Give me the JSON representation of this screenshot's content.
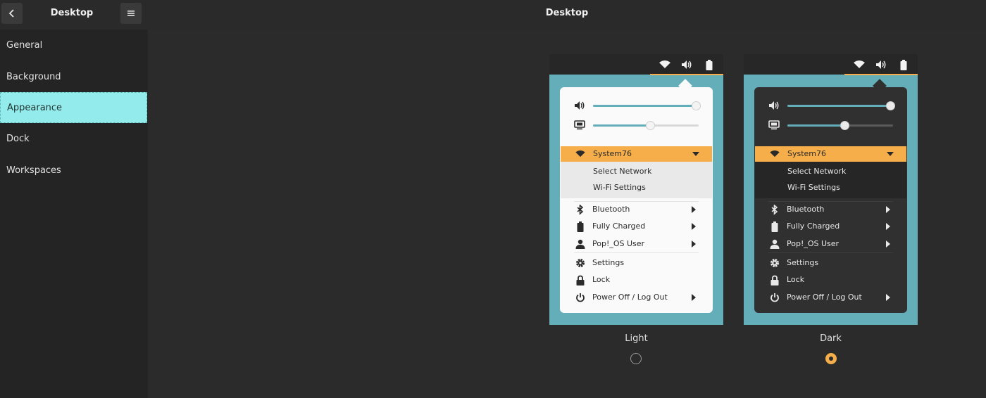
{
  "sidebar": {
    "title": "Desktop",
    "back_icon": "chevron-left-icon",
    "menu_icon": "hamburger-menu-icon",
    "items": [
      {
        "label": "General"
      },
      {
        "label": "Background"
      },
      {
        "label": "Appearance",
        "active": true
      },
      {
        "label": "Dock"
      },
      {
        "label": "Workspaces"
      }
    ]
  },
  "main": {
    "title": "Desktop"
  },
  "preview": {
    "network_name": "System76",
    "submenu": [
      "Select Network",
      "Wi-Fi Settings"
    ],
    "menu_items": [
      {
        "label": "Bluetooth",
        "icon": "bluetooth-icon"
      },
      {
        "label": "Fully Charged",
        "icon": "battery-icon"
      },
      {
        "label": "Pop!_OS User",
        "icon": "user-icon"
      },
      {
        "label": "Settings",
        "icon": "gear-icon"
      },
      {
        "label": "Lock",
        "icon": "lock-icon"
      },
      {
        "label": "Power Off / Log Out",
        "icon": "power-icon"
      }
    ],
    "light": {
      "volume_level": 1.0,
      "brightness_level": 0.55
    },
    "dark": {
      "volume_level": 1.0,
      "brightness_level": 0.55
    }
  },
  "themes": {
    "light_label": "Light",
    "dark_label": "Dark",
    "selected": "dark"
  },
  "colors": {
    "accent": "#f6ae4a",
    "teal": "#63aeb8",
    "active_item": "#94ebeb"
  }
}
